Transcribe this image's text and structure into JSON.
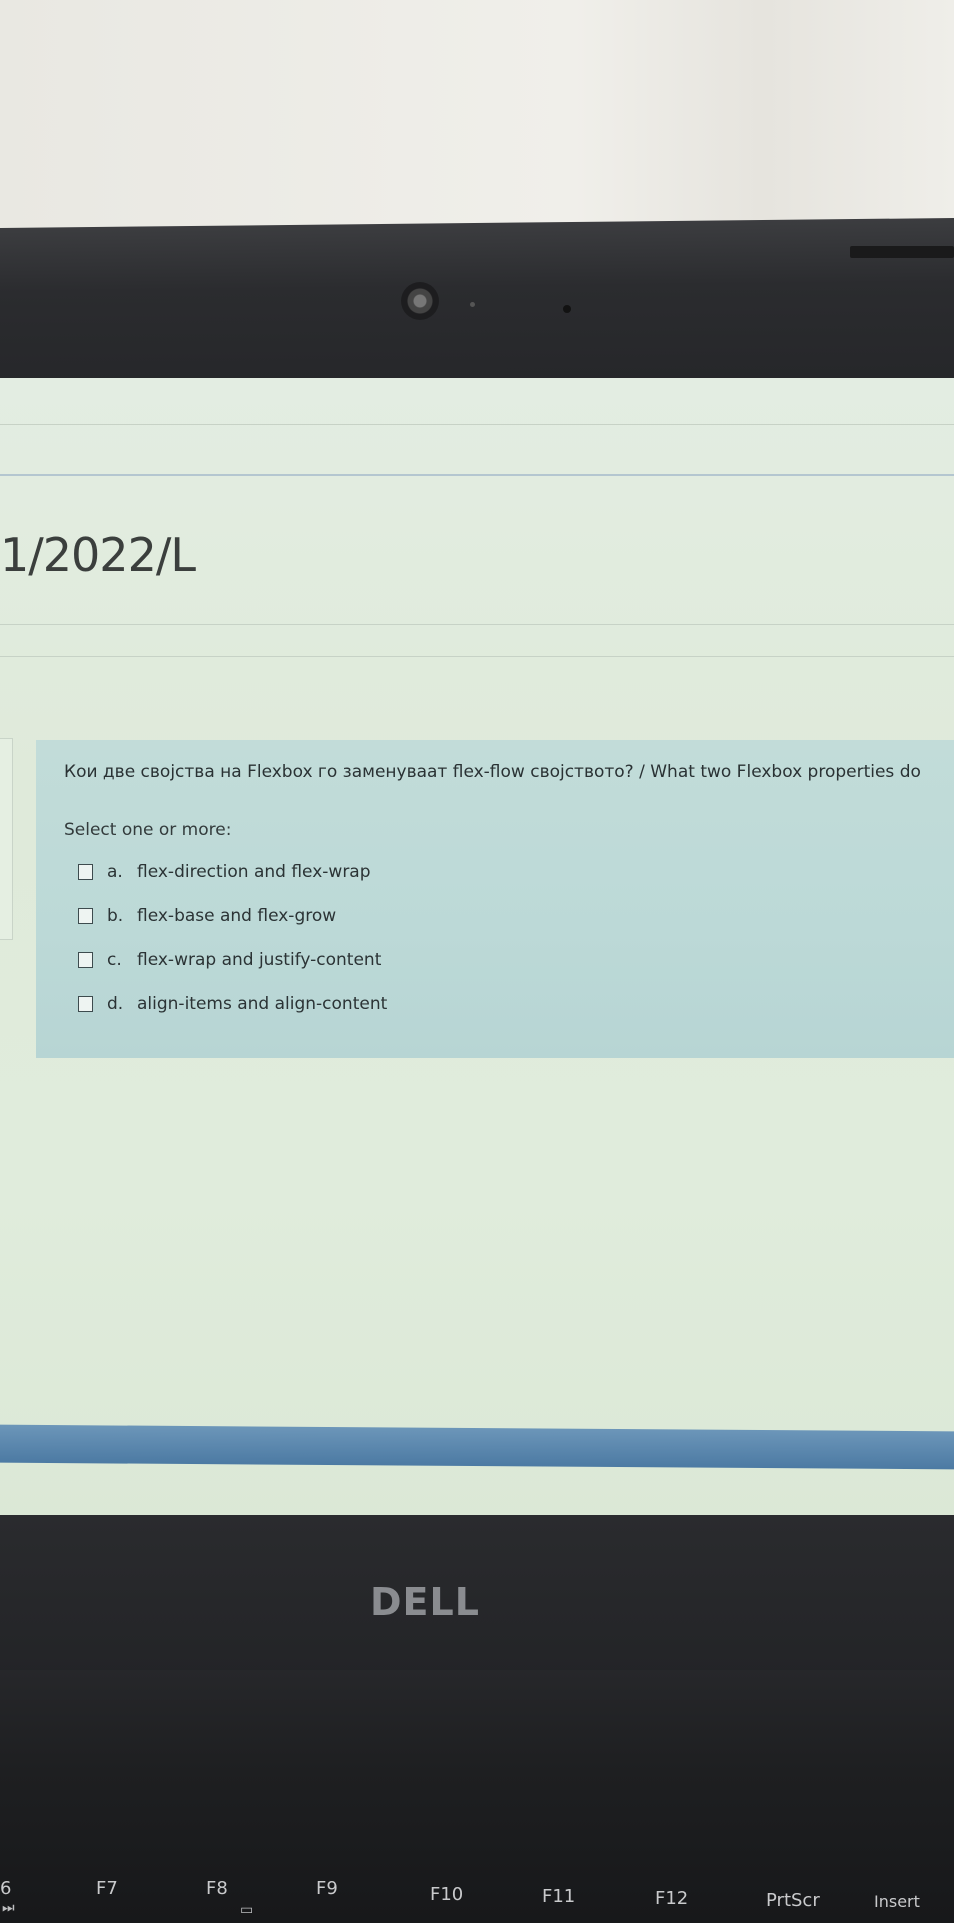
{
  "page": {
    "heading": "1/2022/L"
  },
  "question": {
    "text": "Кои две својства на Flexbox го заменуваат flex-flow својството? / What two Flexbox properties do",
    "prompt": "Select one or more:",
    "answers": [
      {
        "letter": "a.",
        "text": "flex-direction and flex-wrap",
        "checked": false
      },
      {
        "letter": "b.",
        "text": "flex-base and flex-grow",
        "checked": false
      },
      {
        "letter": "c.",
        "text": "flex-wrap and justify-content",
        "checked": false
      },
      {
        "letter": "d.",
        "text": "align-items and align-content",
        "checked": false
      }
    ]
  },
  "laptop": {
    "brand": "DELL",
    "fkeys": [
      "6",
      "F7",
      "F8",
      "F9",
      "F10",
      "F11",
      "F12",
      "PrtScr",
      "Insert"
    ],
    "fkey_icons": [
      "next-track-icon",
      "screen-switch-icon"
    ]
  }
}
